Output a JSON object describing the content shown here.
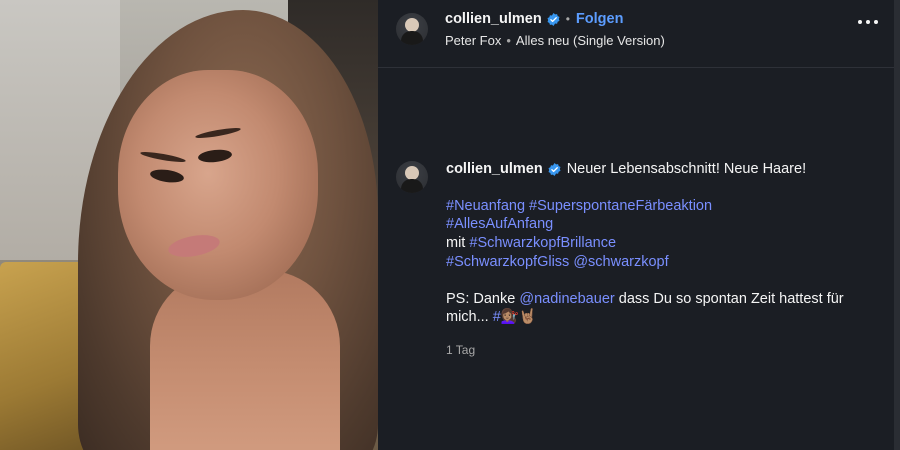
{
  "post_header": {
    "username": "collien_ulmen",
    "follow_label": "Folgen",
    "audio_artist": "Peter Fox",
    "audio_title": "Alles neu (Single Version)"
  },
  "comment": {
    "username": "collien_ulmen",
    "caption": "Neuer Lebensabschnitt! Neue Haare!",
    "hashtags_line1": [
      "#Neuanfang",
      "#SuperspontaneFärbeaktion"
    ],
    "hashtag_line2": "#AllesAufAnfang",
    "line3_prefix": "mit",
    "hashtag_line3": "#SchwarzkopfBrillance",
    "hashtag_line4": "#SchwarzkopfGliss",
    "mention_line4": "@schwarzkopf",
    "ps_prefix": "PS: Danke",
    "ps_mention": "@nadinebauer",
    "ps_suffix": "dass Du so spontan Zeit hattest für mich...",
    "ps_hashtag": "#",
    "ps_emojis": "💇🏽‍♀️🤘🏽",
    "timestamp": "1 Tag"
  },
  "colors": {
    "panel_bg": "#1b1e24",
    "link": "#7a8fff",
    "follow": "#5c9dff",
    "verified": "#3897f0"
  },
  "icons": [
    "verified-badge-icon",
    "more-options-icon"
  ]
}
